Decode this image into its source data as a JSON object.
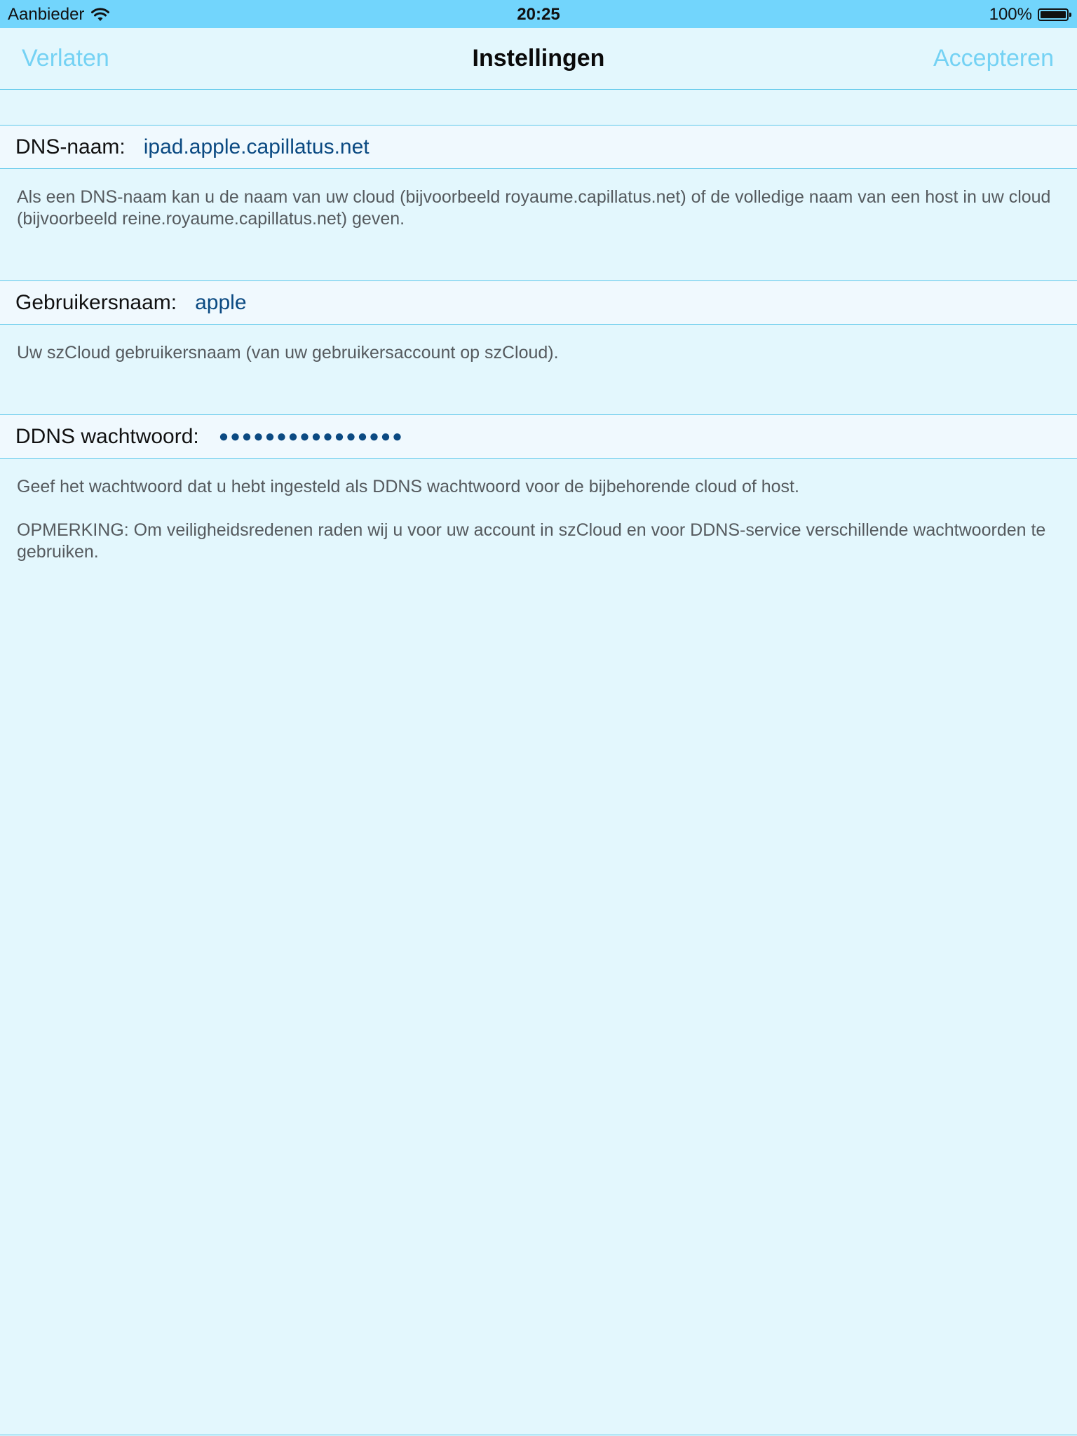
{
  "status_bar": {
    "carrier": "Aanbieder",
    "time": "20:25",
    "battery_percent": "100%",
    "battery_level": 1.0
  },
  "nav": {
    "left_button": "Verlaten",
    "title": "Instellingen",
    "right_button": "Accepteren"
  },
  "fields": {
    "dns": {
      "label": "DNS-naam:",
      "value": "ipad.apple.capillatus.net",
      "help": "Als een DNS-naam kan u de naam van uw cloud (bijvoorbeeld royaume.capillatus.net) of de volledige naam van een host in uw cloud (bijvoorbeeld reine.royaume.capillatus.net) geven."
    },
    "username": {
      "label": "Gebruikersnaam:",
      "value": "apple",
      "help": "Uw szCloud gebruikersnaam (van uw gebruikersaccount op szCloud)."
    },
    "password": {
      "label": "DDNS wachtwoord:",
      "masked": "●●●●●●●●●●●●●●●●",
      "help": "Geef het wachtwoord dat u hebt ingesteld als DDNS wachtwoord voor de bijbehorende cloud of host.",
      "note": "OPMERKING: Om veiligheidsredenen raden wij u voor uw account in szCloud en voor DDNS-service verschillende wachtwoorden te gebruiken."
    }
  },
  "colors": {
    "background": "#e3f7fd",
    "status_bar": "#72d5fc",
    "nav_button": "#74d2f4",
    "value_text": "#0b4a82",
    "separator": "#5fc8ea"
  },
  "icons": {
    "wifi": "wifi-icon",
    "battery": "battery-icon"
  }
}
